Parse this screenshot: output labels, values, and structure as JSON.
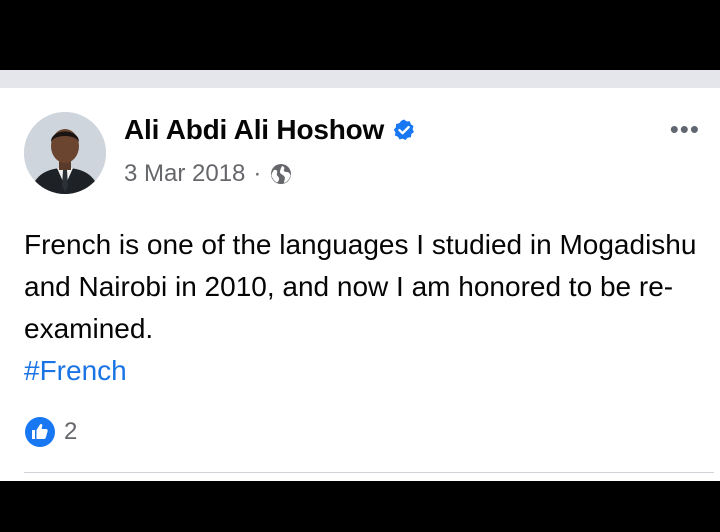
{
  "post": {
    "author": "Ali Abdi Ali Hoshow",
    "date": "3 Mar 2018",
    "separator": "·",
    "more_label": "•••",
    "text": "French is one of the languages I studied in Mogadishu and Nairobi in 2010, and now I am honored to be re-examined.",
    "hashtag": "#French",
    "like_count": "2",
    "icons": {
      "avatar": "profile-photo",
      "verified": "verified-badge-icon",
      "audience": "globe-icon",
      "more": "more-options-icon",
      "reaction": "like-icon"
    },
    "colors": {
      "link": "#1b74e4",
      "verified": "#1877f2",
      "like": "#1877f2",
      "meta": "#65676b"
    }
  }
}
